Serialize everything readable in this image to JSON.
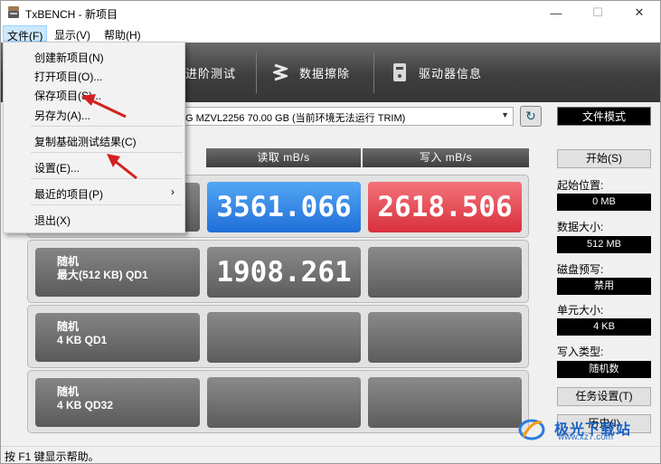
{
  "window": {
    "title": "TxBENCH - 新项目",
    "minimize": "—",
    "maximize": "☐",
    "close": "✕"
  },
  "menubar": {
    "file": "文件(F)",
    "view": "显示(V)",
    "help": "帮助(H)"
  },
  "file_menu": {
    "new_project": "创建新项目(N)",
    "open_project": "打开项目(O)...",
    "save_project": "保存项目(S)...",
    "save_as": "另存为(A)...",
    "copy_results": "复制基础测试结果(C)",
    "settings": "设置(E)...",
    "recent": "最近的项目(P)",
    "recent_arrow": "›",
    "exit": "退出(X)"
  },
  "toolbar": {
    "advanced": "进阶测试",
    "erase": "数据擦除",
    "driver_info": "驱动器信息"
  },
  "drive": {
    "selected": "G MZVL2256  70.00 GB (当前环境无法运行 TRIM)",
    "caret": "▼",
    "refresh": "↻"
  },
  "mode": "文件模式",
  "columns": {
    "read": "读取 mB/s",
    "write": "写入 mB/s"
  },
  "rows": [
    {
      "line1": "",
      "line2": "",
      "read": "3561.066",
      "write": "2618.506"
    },
    {
      "line1": "随机",
      "line2": "最大(512 KB) QD1",
      "read": "1908.261",
      "write": ""
    },
    {
      "line1": "随机",
      "line2": "4 KB QD1",
      "read": "",
      "write": ""
    },
    {
      "line1": "随机",
      "line2": "4 KB QD32",
      "read": "",
      "write": ""
    }
  ],
  "side": {
    "start": "开始(S)",
    "start_pos_label": "起始位置:",
    "start_pos": "0 MB",
    "data_size_label": "数据大小:",
    "data_size": "512 MB",
    "prewrite_label": "磁盘预写:",
    "prewrite": "禁用",
    "unit_size_label": "单元大小:",
    "unit_size": "4 KB",
    "write_type_label": "写入类型:",
    "write_type": "随机数",
    "task_settings": "任务设置(T)",
    "history": "历史(I)"
  },
  "status": "按 F1 键显示帮助。",
  "watermark": {
    "title": "极光下载站",
    "url": "www.xz7.com"
  },
  "colors": {
    "read_highlight": "#2f86eb",
    "write_highlight": "#e6444f",
    "arrow": "#d42020"
  }
}
